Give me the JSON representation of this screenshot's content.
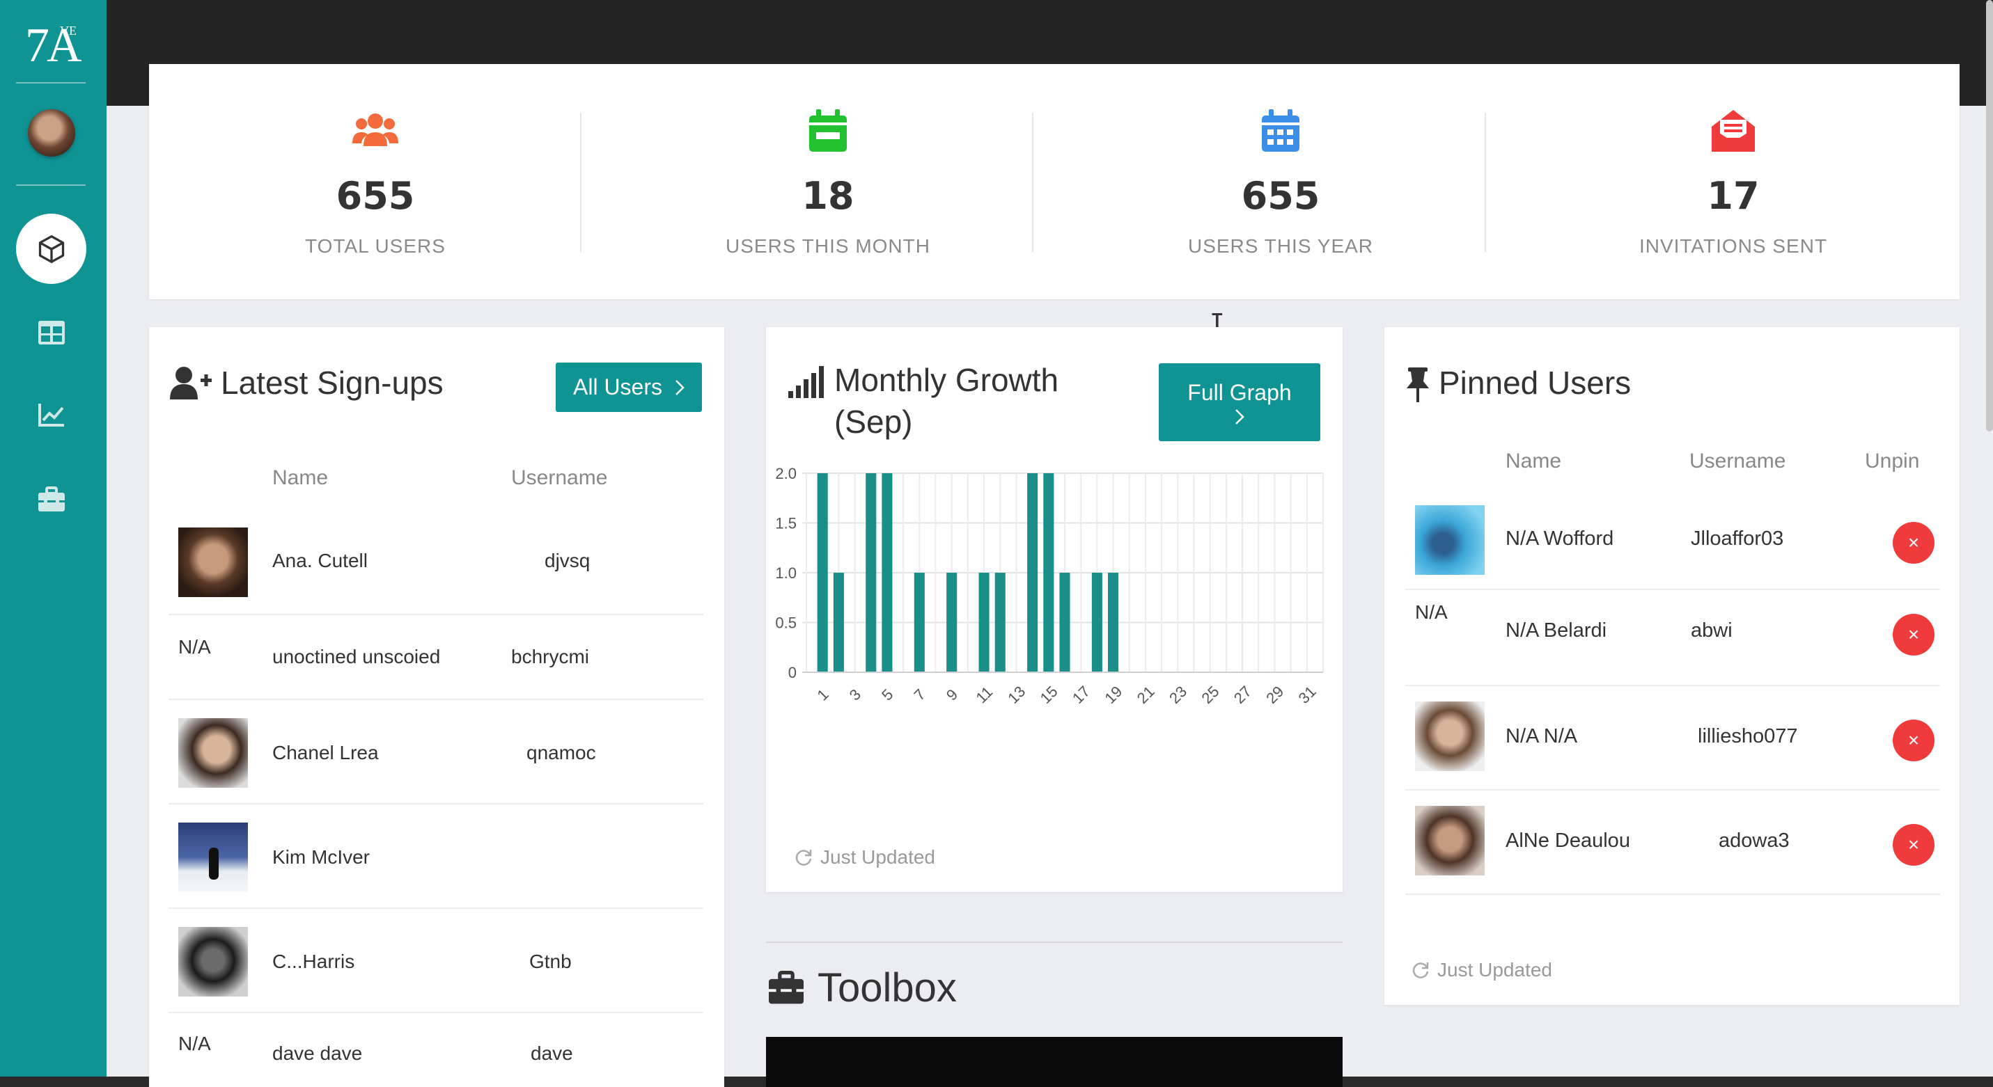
{
  "sidebar": {
    "logo_text": "7A",
    "logo_superscript": "VE",
    "nav": [
      {
        "icon": "cube-icon",
        "active": true
      },
      {
        "icon": "table-icon",
        "active": false
      },
      {
        "icon": "chart-line-icon",
        "active": false
      },
      {
        "icon": "toolbox-icon",
        "active": false
      }
    ]
  },
  "stats": [
    {
      "value": "655",
      "label": "TOTAL USERS",
      "icon": "users-icon",
      "color": "#f36b3b"
    },
    {
      "value": "18",
      "label": "USERS THIS MONTH",
      "icon": "calendar-minus-icon",
      "color": "#22c12f"
    },
    {
      "value": "655",
      "label": "USERS THIS YEAR",
      "icon": "calendar-icon",
      "color": "#3b8fe8"
    },
    {
      "value": "17",
      "label": "INVITATIONS SENT",
      "icon": "envelope-open-icon",
      "color": "#ef3b3b"
    }
  ],
  "signups": {
    "title": "Latest Sign-ups",
    "button": "All Users",
    "headers": {
      "name": "Name",
      "username": "Username"
    },
    "rows": [
      {
        "avatar": true,
        "name": "Ana. Cutell",
        "username": "djvsq"
      },
      {
        "avatar": false,
        "na": "N/A",
        "name": "unoctined unscoied",
        "username": "bchrycmi"
      },
      {
        "avatar": true,
        "name": "Chanel Lrea",
        "username": "qnamoc"
      },
      {
        "avatar": true,
        "name": "Kim McIver",
        "username": ""
      },
      {
        "avatar": true,
        "name": "C...Harris",
        "username": "Gtnb"
      },
      {
        "avatar": false,
        "na": "N/A",
        "name": "dave dave",
        "username": "dave"
      }
    ]
  },
  "growth": {
    "title": "Monthly Growth (Sep)",
    "button": "Full Graph",
    "updated": "Just Updated"
  },
  "chart_data": {
    "type": "bar",
    "title": "Monthly Growth (Sep)",
    "categories": [
      "1",
      "2",
      "3",
      "4",
      "5",
      "6",
      "7",
      "8",
      "9",
      "10",
      "11",
      "12",
      "13",
      "14",
      "15",
      "16",
      "17",
      "18",
      "19",
      "20",
      "21",
      "22",
      "23",
      "24",
      "25",
      "26",
      "27",
      "28",
      "29",
      "30",
      "31"
    ],
    "x_tick_labels": [
      "1",
      "3",
      "5",
      "7",
      "9",
      "11",
      "13",
      "15",
      "17",
      "19",
      "21",
      "23",
      "25",
      "27",
      "29",
      "31"
    ],
    "values": [
      2,
      1,
      0,
      2,
      2,
      0,
      1,
      0,
      1,
      0,
      1,
      1,
      0,
      2,
      2,
      1,
      0,
      1,
      1,
      0,
      0,
      0,
      0,
      0,
      0,
      0,
      0,
      0,
      0,
      0,
      0
    ],
    "y_ticks": [
      "0",
      "0.5",
      "1.0",
      "1.5",
      "2.0"
    ],
    "ylim": [
      0,
      2
    ],
    "xlabel": "",
    "ylabel": "",
    "color": "#1a8f8a",
    "grid": true
  },
  "pinned": {
    "title": "Pinned Users",
    "headers": {
      "name": "Name",
      "username": "Username",
      "unpin": "Unpin"
    },
    "rows": [
      {
        "avatar": true,
        "name": "N/A Wofford",
        "username": "Jlloaffor03"
      },
      {
        "avatar": false,
        "na": "N/A",
        "name": "N/A Belardi",
        "username": "abwi"
      },
      {
        "avatar": true,
        "name": "N/A N/A",
        "username": "lilliesho077"
      },
      {
        "avatar": true,
        "name": "AlNe Deaulou",
        "username": "adowa3"
      }
    ],
    "unpin_symbol": "×",
    "updated": "Just Updated"
  },
  "toolbox": {
    "title": "Toolbox"
  }
}
